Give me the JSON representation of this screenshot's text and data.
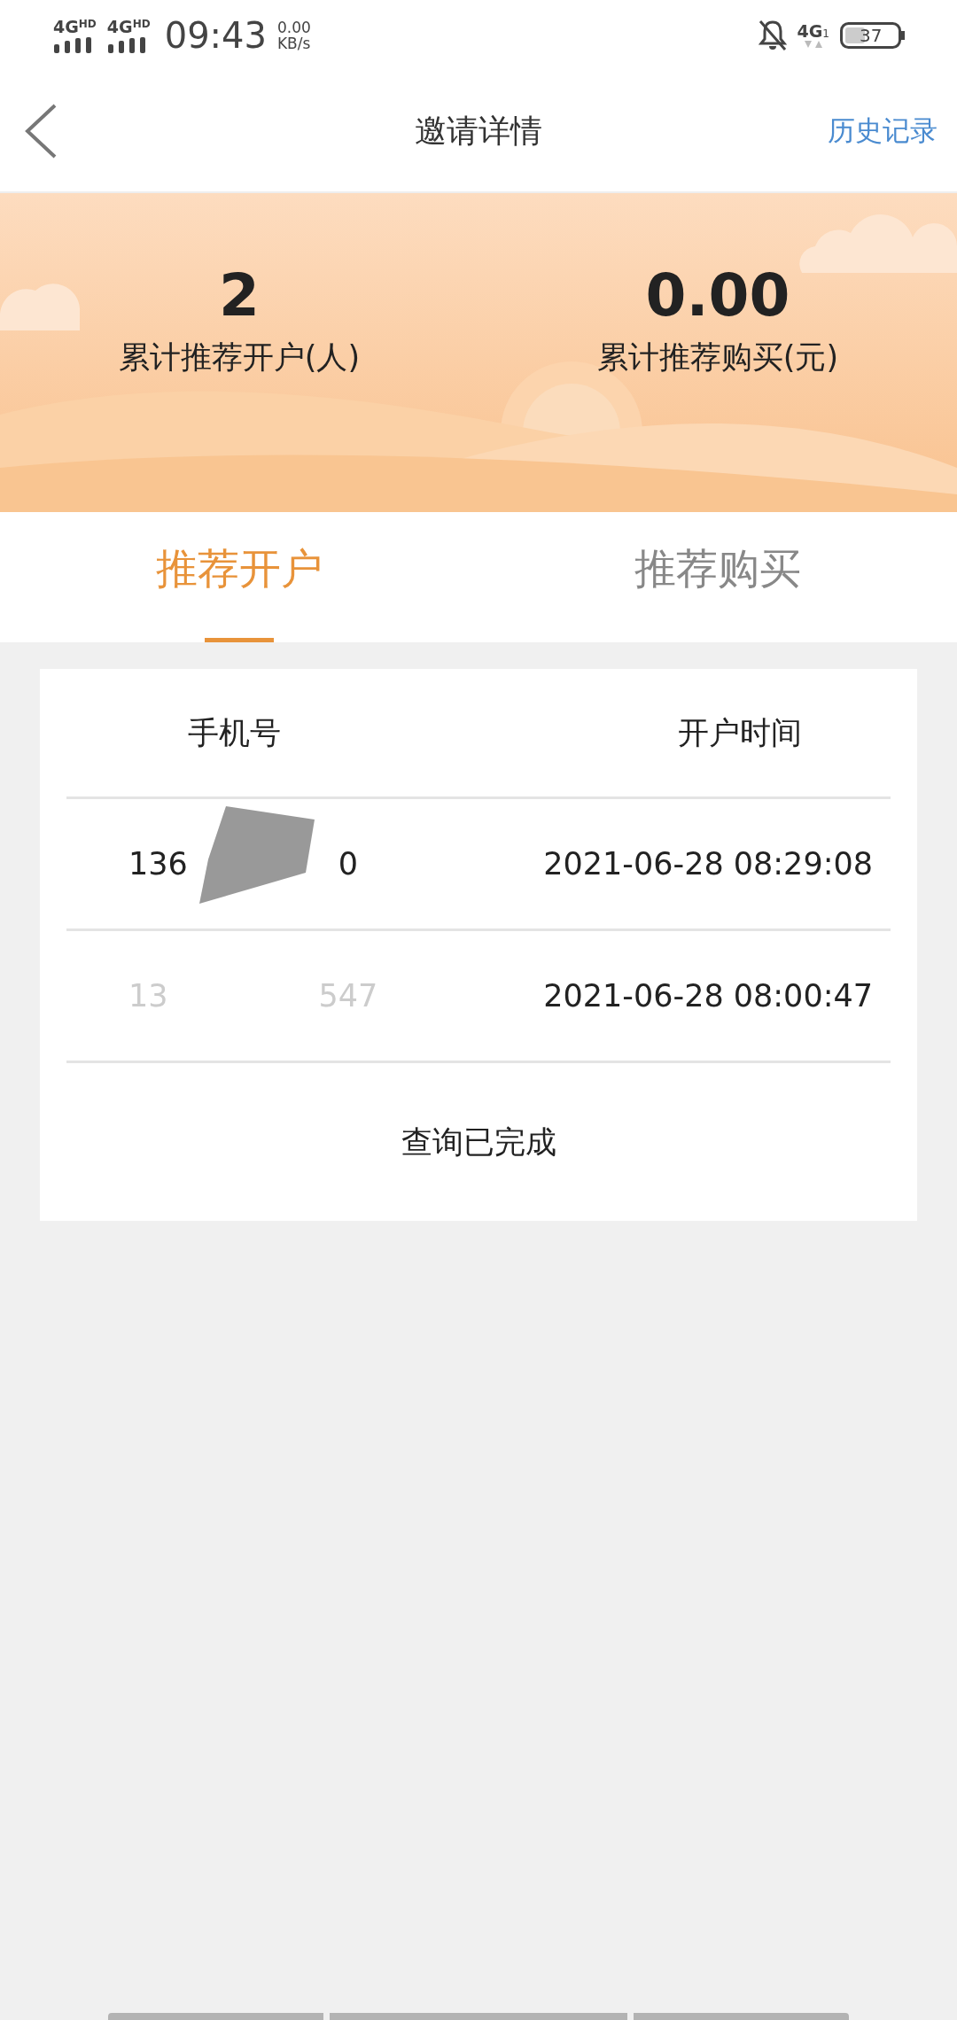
{
  "status_bar": {
    "network_1": "4G",
    "network_1_tag": "HD",
    "network_2": "4G",
    "network_2_tag": "HD",
    "time": "09:43",
    "speed_value": "0.00",
    "speed_unit": "KB/s",
    "mobile_data": "4G",
    "mobile_data_sim": "1",
    "battery": "37"
  },
  "nav": {
    "title": "邀请详情",
    "action": "历史记录"
  },
  "summary": [
    {
      "value": "2",
      "label": "累计推荐开户(人)"
    },
    {
      "value": "0.00",
      "label": "累计推荐购买(元)"
    }
  ],
  "tabs": [
    {
      "label": "推荐开户",
      "selected": true
    },
    {
      "label": "推荐购买",
      "selected": false
    }
  ],
  "table": {
    "columns": [
      "手机号",
      "开户时间"
    ],
    "rows": [
      {
        "phone_start": "136",
        "phone_end": "0",
        "time": "2021-06-28 08:29:08",
        "scribbled": true,
        "faded": false
      },
      {
        "phone_start": "13",
        "phone_end": "547",
        "time": "2021-06-28 08:00:47",
        "scribbled": false,
        "faded": true
      }
    ],
    "footer": "查询已完成"
  }
}
